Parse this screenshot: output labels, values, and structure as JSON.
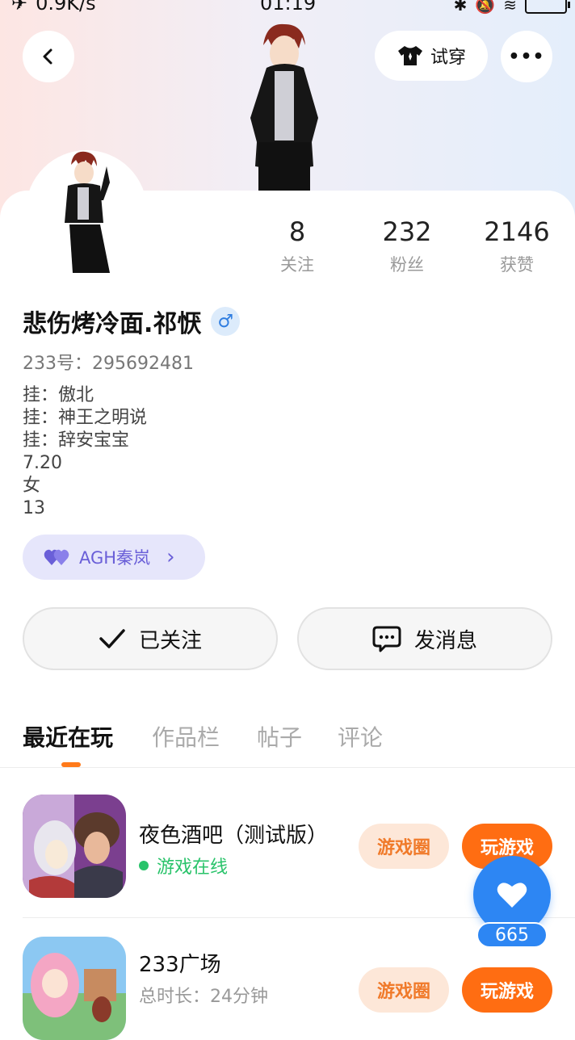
{
  "status_bar": {
    "speed": "0.9K/s",
    "time": "01:19"
  },
  "header": {
    "try_on_label": "试穿",
    "more_label": "•••"
  },
  "stats": [
    {
      "value": "8",
      "label": "关注"
    },
    {
      "value": "232",
      "label": "粉丝"
    },
    {
      "value": "2146",
      "label": "获赞"
    }
  ],
  "profile": {
    "name": "悲伤烤冷面.祁恹",
    "gender_symbol": "♂",
    "uid": "233号：295692481",
    "bio": [
      "挂：傲北",
      "挂：神王之明说",
      "挂：辞安宝宝",
      "7.20",
      "女",
      "13"
    ]
  },
  "cp": {
    "label": "AGH秦岚",
    "arrow": "›"
  },
  "actions": {
    "follow_label": "已关注",
    "message_label": "发消息"
  },
  "tabs": [
    "最近在玩",
    "作品栏",
    "帖子",
    "评论"
  ],
  "games": [
    {
      "title": "夜色酒吧（测试版）",
      "subtitle": "游戏在线",
      "circle_label": "游戏圈",
      "play_label": "玩游戏"
    },
    {
      "title": "233广场",
      "subtitle": "总时长：24分钟",
      "circle_label": "游戏圈",
      "play_label": "玩游戏"
    }
  ],
  "likes": {
    "count": "665"
  },
  "colors": {
    "accent_orange": "#ff6d12",
    "like_blue": "#2d86f3",
    "online_green": "#29c36a",
    "cp_purple": "#6a5fd8"
  }
}
